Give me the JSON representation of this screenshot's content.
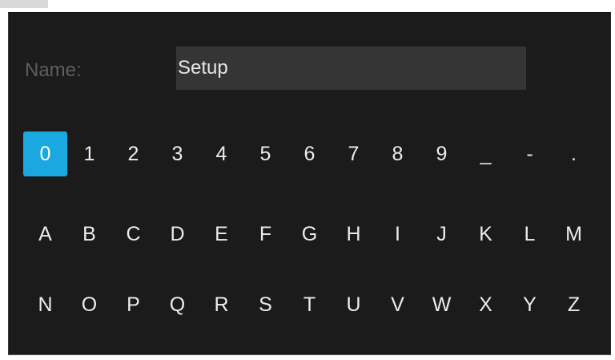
{
  "name_field": {
    "label": "Name:",
    "value": "Setup"
  },
  "keyboard": {
    "selected_key": "0",
    "selected_color": "#1ba8e0",
    "rows": [
      [
        "0",
        "1",
        "2",
        "3",
        "4",
        "5",
        "6",
        "7",
        "8",
        "9",
        "_",
        "-",
        "."
      ],
      [
        "A",
        "B",
        "C",
        "D",
        "E",
        "F",
        "G",
        "H",
        "I",
        "J",
        "K",
        "L",
        "M"
      ],
      [
        "N",
        "O",
        "P",
        "Q",
        "R",
        "S",
        "T",
        "U",
        "V",
        "W",
        "X",
        "Y",
        "Z"
      ]
    ]
  }
}
